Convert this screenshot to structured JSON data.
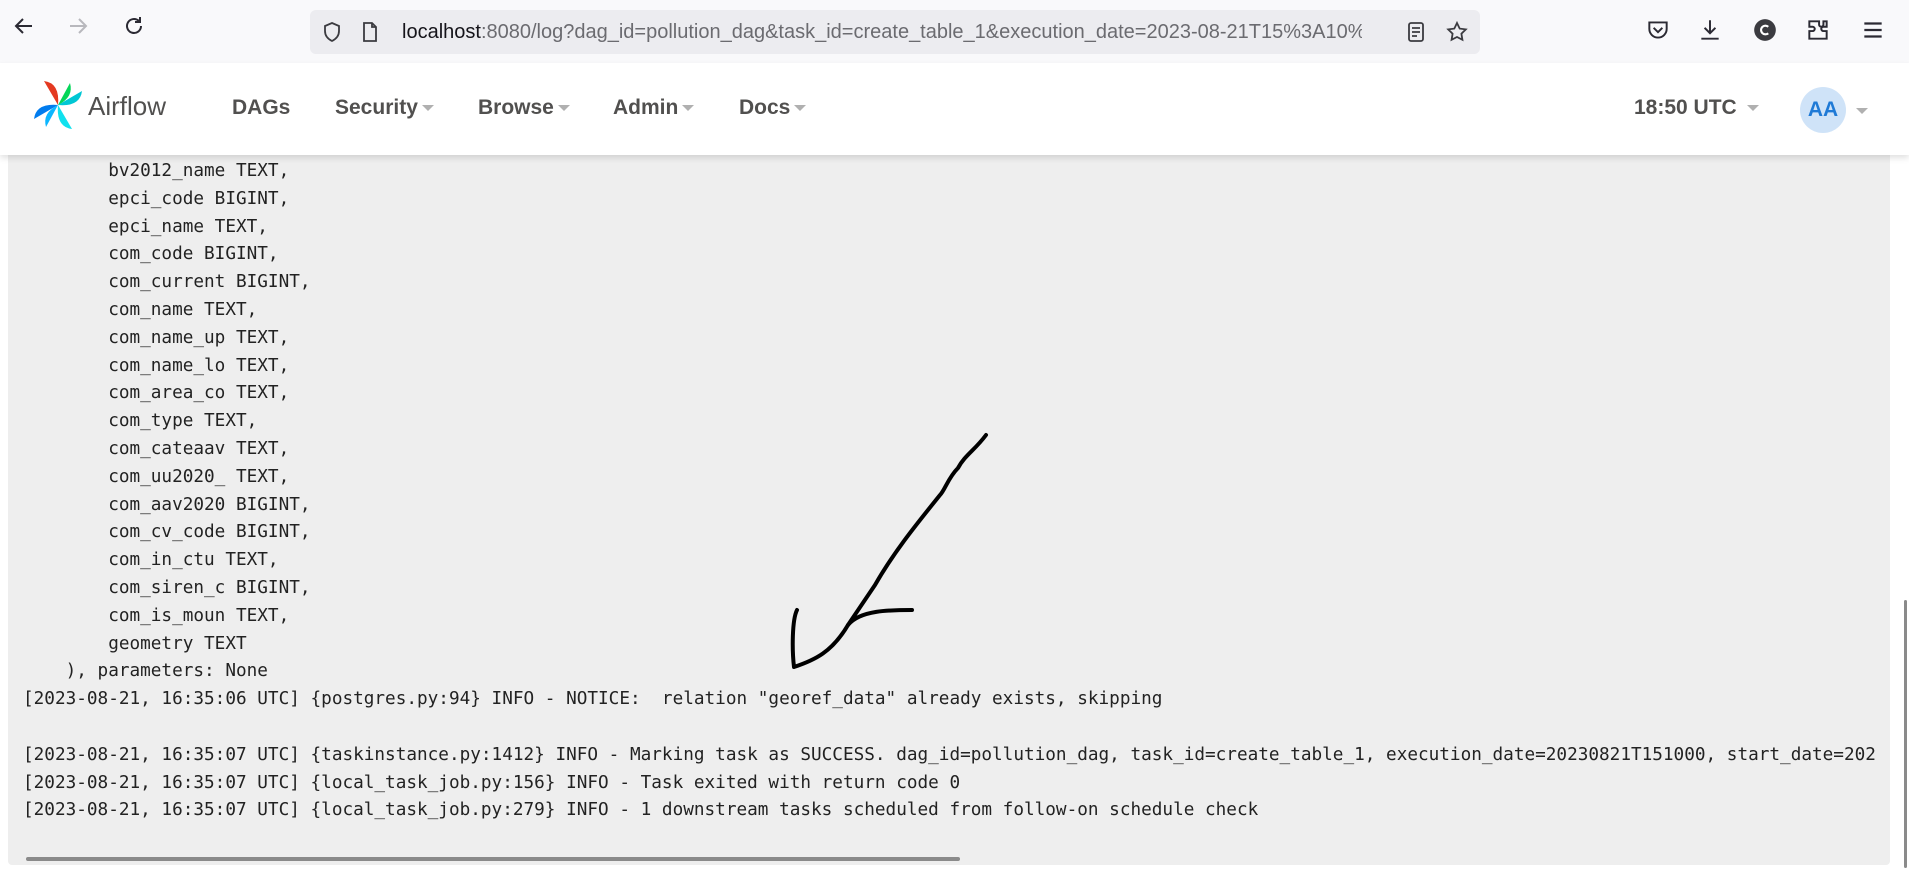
{
  "browser": {
    "url_host": "localhost",
    "url_rest": ":8080/log?dag_id=pollution_dag&task_id=create_table_1&execution_date=2023-08-21T15%3A10%"
  },
  "navbar": {
    "brand": "Airflow",
    "menu": [
      "DAGs",
      "Security",
      "Browse",
      "Admin",
      "Docs"
    ],
    "time": "18:50 UTC",
    "avatar_initials": "AA"
  },
  "log": {
    "lines": [
      "        bv2012_name TEXT,",
      "        epci_code BIGINT,",
      "        epci_name TEXT,",
      "        com_code BIGINT,",
      "        com_current BIGINT,",
      "        com_name TEXT,",
      "        com_name_up TEXT,",
      "        com_name_lo TEXT,",
      "        com_area_co TEXT,",
      "        com_type TEXT,",
      "        com_cateaav TEXT,",
      "        com_uu2020_ TEXT,",
      "        com_aav2020 BIGINT,",
      "        com_cv_code BIGINT,",
      "        com_in_ctu TEXT,",
      "        com_siren_c BIGINT,",
      "        com_is_moun TEXT,",
      "        geometry TEXT",
      "    ), parameters: None",
      "[2023-08-21, 16:35:06 UTC] {postgres.py:94} INFO - NOTICE:  relation \"georef_data\" already exists, skipping",
      "",
      "[2023-08-21, 16:35:07 UTC] {taskinstance.py:1412} INFO - Marking task as SUCCESS. dag_id=pollution_dag, task_id=create_table_1, execution_date=20230821T151000, start_date=202",
      "[2023-08-21, 16:35:07 UTC] {local_task_job.py:156} INFO - Task exited with return code 0",
      "[2023-08-21, 16:35:07 UTC] {local_task_job.py:279} INFO - 1 downstream tasks scheduled from follow-on schedule check"
    ]
  },
  "colors": {
    "log_background": "#eeeeee",
    "avatar_background": "#cfe3f8",
    "avatar_text": "#1f7ad6"
  }
}
